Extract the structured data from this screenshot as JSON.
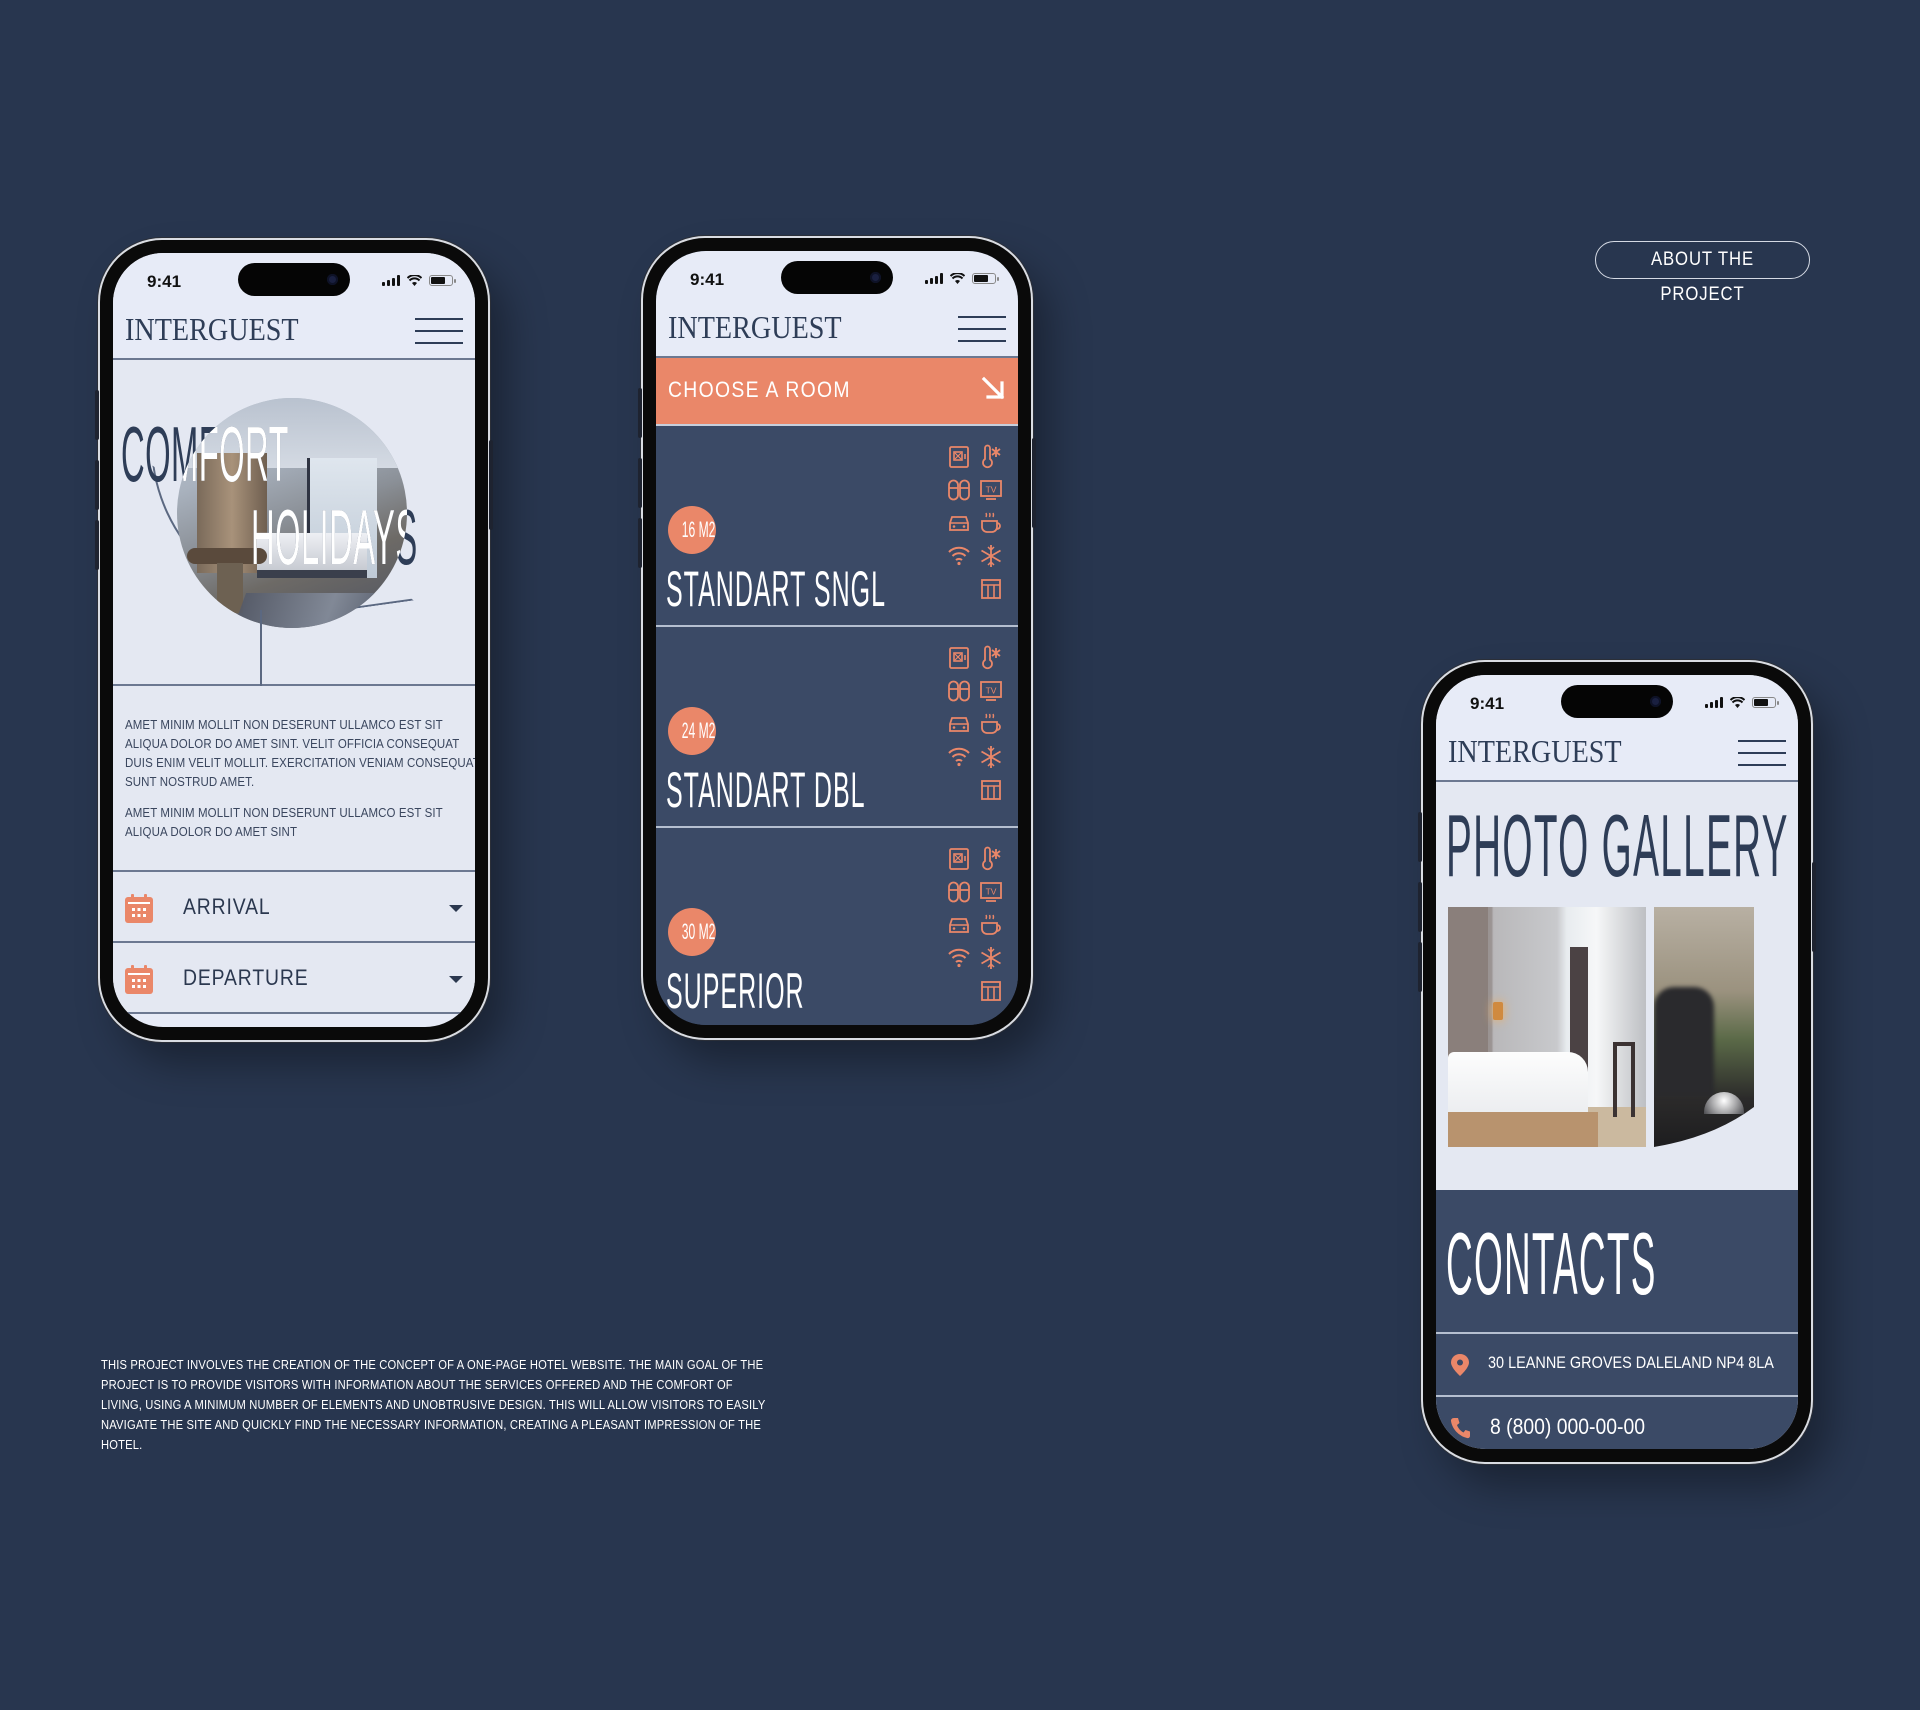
{
  "colors": {
    "page_background": "#28364f",
    "screen_light": "#e7ebf7",
    "panel_dark": "#3b4a66",
    "accent": "#ea8769",
    "ink": "#2e3d57",
    "white": "#ffffff"
  },
  "about_button": {
    "label": "ABOUT THE PROJECT"
  },
  "project_description": "THIS PROJECT INVOLVES THE CREATION OF THE CONCEPT OF A ONE-PAGE HOTEL WEBSITE. THE MAIN GOAL OF THE PROJECT IS TO PROVIDE VISITORS WITH INFORMATION ABOUT THE SERVICES OFFERED AND THE COMFORT OF LIVING, USING A MINIMUM NUMBER OF ELEMENTS AND UNOBTRUSIVE DESIGN. THIS WILL ALLOW VISITORS TO EASILY NAVIGATE THE SITE AND QUICKLY FIND THE NECESSARY INFORMATION, CREATING A PLEASANT IMPRESSION OF THE HOTEL.",
  "status_bar": {
    "time": "9:41",
    "icons": [
      "cellular-signal-icon",
      "wifi-icon",
      "battery-icon"
    ]
  },
  "brand": {
    "logo": "INTERGUEST",
    "menu_icon": "hamburger-menu-icon"
  },
  "home_screen": {
    "hero_line_1": "COMFORT",
    "hero_line_2": "HOLIDAYS",
    "paragraphs": [
      "AMET MINIM MOLLIT NON DESERUNT ULLAMCO EST SIT ALIQUA DOLOR DO AMET SINT. VELIT OFFICIA CONSEQUAT DUIS ENIM VELIT MOLLIT. EXERCITATION VENIAM CONSEQUAT SUNT NOSTRUD AMET.",
      "AMET MINIM MOLLIT NON DESERUNT ULLAMCO EST SIT ALIQUA DOLOR DO AMET SINT"
    ],
    "date_selects": [
      {
        "label": "ARRIVAL",
        "icon": "calendar-icon"
      },
      {
        "label": "DEPARTURE",
        "icon": "calendar-icon"
      }
    ]
  },
  "rooms_screen": {
    "cta_label": "CHOOSE A ROOM",
    "cta_icon": "arrow-down-right-icon",
    "amenity_icons": [
      "safe-icon",
      "thermometer-cold-icon",
      "slippers-icon",
      "tv-icon",
      "car-icon",
      "hot-drink-icon",
      "wifi-icon",
      "snowflake-icon",
      "wardrobe-icon"
    ],
    "rooms": [
      {
        "area": "16 M2",
        "name": "STANDART SNGL"
      },
      {
        "area": "24 M2",
        "name": "STANDART DBL"
      },
      {
        "area": "30 M2",
        "name": "SUPERIOR"
      }
    ]
  },
  "info_screen": {
    "gallery_title": "PHOTO GALLERY",
    "contacts_title": "CONTACTS",
    "address": "30 LEANNE GROVES DALELAND NP4 8LA",
    "phone": "8 (800) 000-00-00"
  }
}
